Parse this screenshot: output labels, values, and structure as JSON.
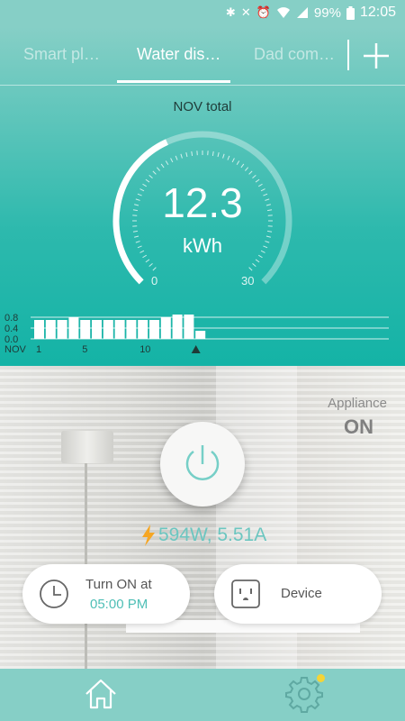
{
  "status_bar": {
    "icons": [
      "bluetooth-icon",
      "mute-icon",
      "alarm-icon",
      "wifi-icon",
      "signal-icon",
      "battery-icon"
    ],
    "battery": "99%",
    "time": "12:05"
  },
  "tabs": [
    {
      "label": "Smart pl…",
      "active": false
    },
    {
      "label": "Water dis…",
      "active": true
    },
    {
      "label": "Dad com…",
      "active": false
    }
  ],
  "summary": {
    "month_total_label": "NOV total",
    "value": "12.3",
    "unit": "kWh",
    "gauge_min": "0",
    "gauge_max": "30"
  },
  "chart_data": {
    "type": "bar",
    "x": [
      1,
      2,
      3,
      4,
      5,
      6,
      7,
      8,
      9,
      10,
      11,
      12,
      13,
      14,
      15
    ],
    "values": [
      0.7,
      0.7,
      0.7,
      0.8,
      0.7,
      0.7,
      0.7,
      0.7,
      0.7,
      0.7,
      0.7,
      0.8,
      0.9,
      0.9,
      0.3
    ],
    "y_ticks": [
      "0.8",
      "0.4",
      "0.0"
    ],
    "x_ticks": [
      {
        "x": 1,
        "label": "1"
      },
      {
        "x": 5,
        "label": "5"
      },
      {
        "x": 10,
        "label": "10"
      }
    ],
    "month_label": "NOV",
    "ylim": [
      0,
      1.0
    ],
    "current_day": 15
  },
  "appliance": {
    "label": "Appliance",
    "state": "ON"
  },
  "power_button_icon": "power-icon",
  "reading": {
    "icon": "lightning-icon",
    "text": "594W, 5.51A"
  },
  "schedule_card": {
    "icon": "clock-icon",
    "line1": "Turn ON at",
    "line2": "05:00 PM"
  },
  "device_card": {
    "icon": "outlet-icon",
    "label": "Device"
  },
  "bottom_nav": {
    "items": [
      "home-icon",
      "settings-icon"
    ]
  },
  "colors": {
    "teal": "#14b3a6",
    "teal_light": "#86cfc6",
    "accent_text": "#4fbfb6",
    "lightning": "#f5a623",
    "notification_dot": "#f4d437"
  }
}
